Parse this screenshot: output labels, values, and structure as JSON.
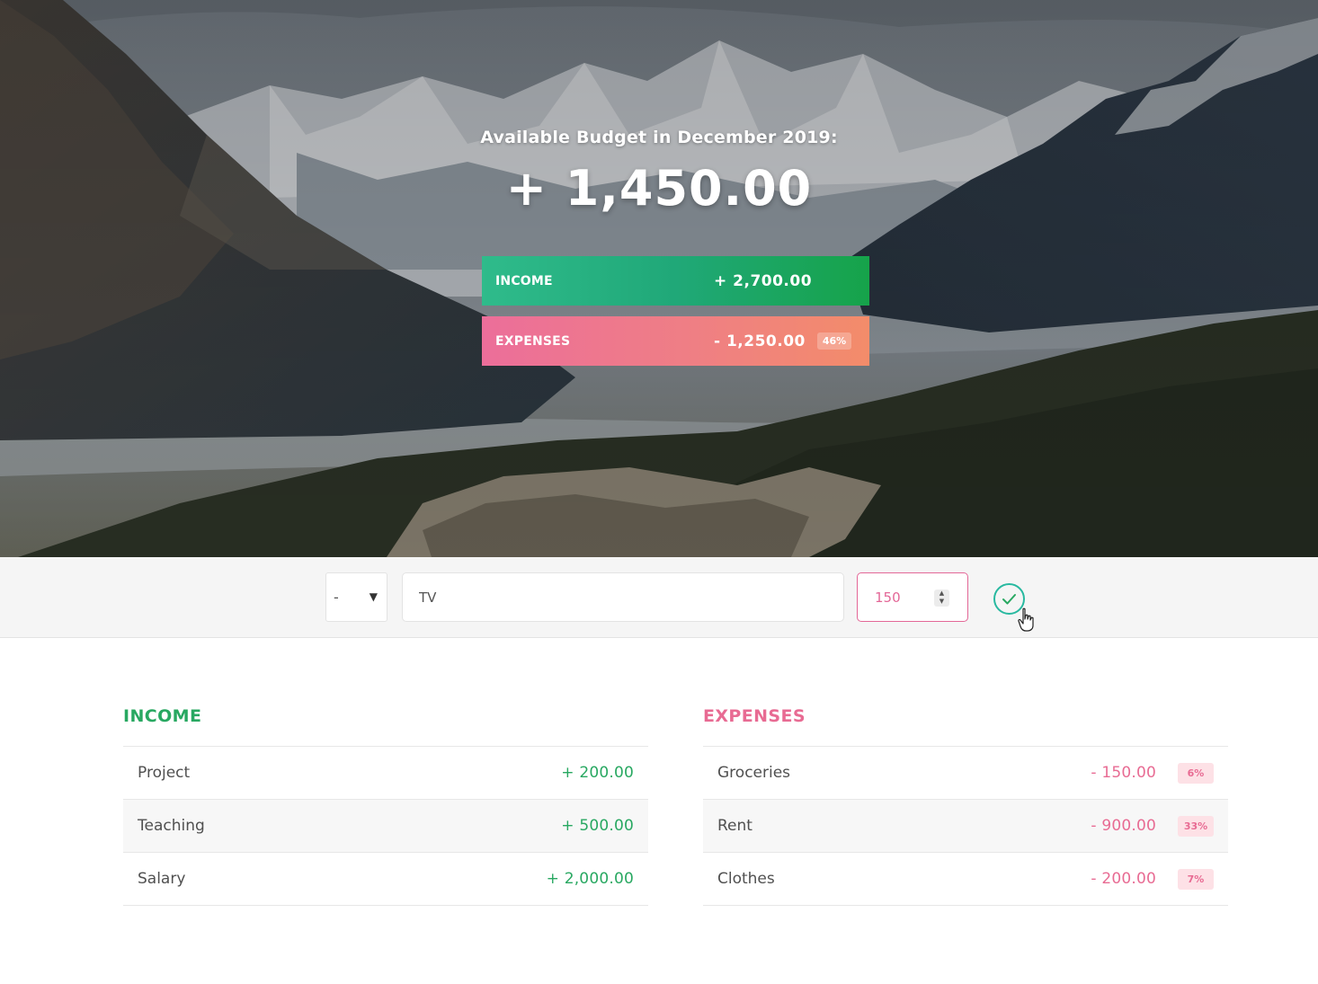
{
  "header": {
    "budget_title": "Available Budget in December 2019:",
    "budget_value": "+ 1,450.00",
    "income": {
      "label": "Income",
      "value": "+ 2,700.00"
    },
    "expenses": {
      "label": "Expenses",
      "value": "- 1,250.00",
      "percentage": "46%"
    }
  },
  "add_bar": {
    "type_value": "-",
    "description_value": "TV",
    "amount_value": "150",
    "submit_icon": "check-circle-icon"
  },
  "income_list": {
    "title": "Income",
    "items": [
      {
        "description": "Project",
        "value": "+ 200.00"
      },
      {
        "description": "Teaching",
        "value": "+ 500.00"
      },
      {
        "description": "Salary",
        "value": "+ 2,000.00"
      }
    ]
  },
  "expenses_list": {
    "title": "Expenses",
    "items": [
      {
        "description": "Groceries",
        "value": "- 150.00",
        "percentage": "6%"
      },
      {
        "description": "Rent",
        "value": "- 900.00",
        "percentage": "33%"
      },
      {
        "description": "Clothes",
        "value": "- 200.00",
        "percentage": "7%"
      }
    ]
  },
  "colors": {
    "income": "#28a861",
    "expenses": "#e86b93",
    "accent": "#28b9a0"
  }
}
